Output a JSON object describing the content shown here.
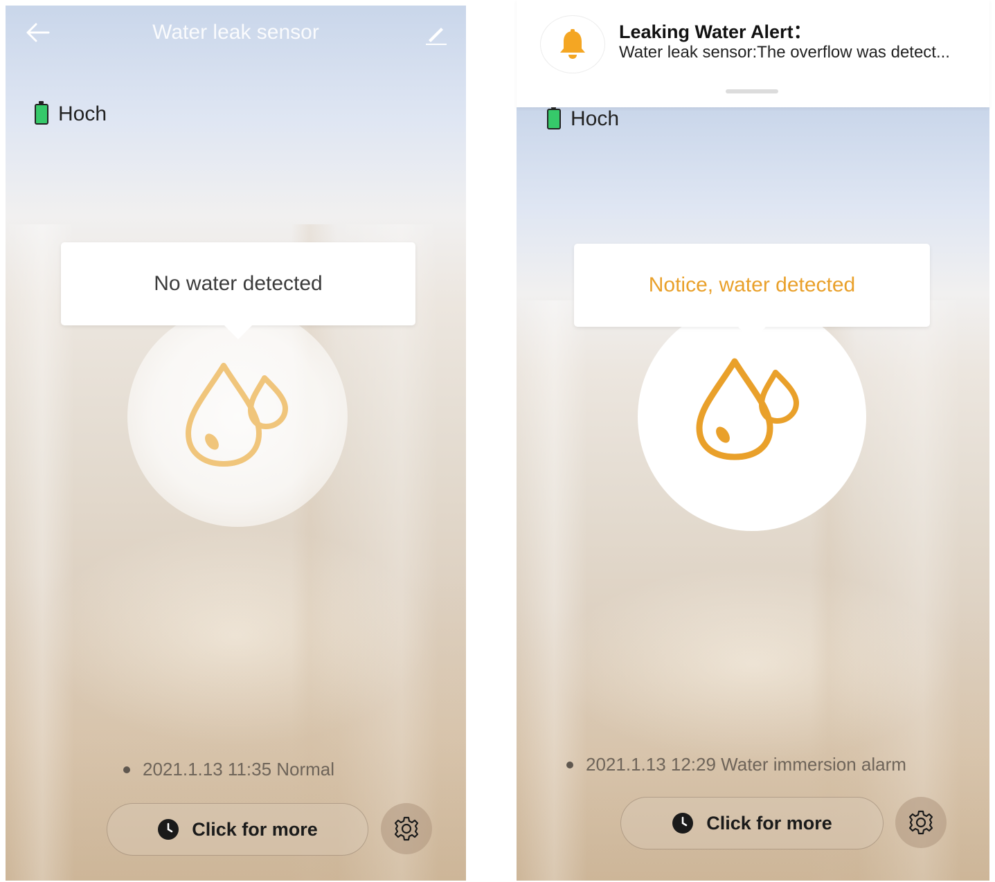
{
  "left_screen": {
    "header": {
      "title": "Water leak sensor"
    },
    "battery": {
      "label": "Hoch"
    },
    "status": {
      "text": "No water detected"
    },
    "log": {
      "entry": "2021.1.13 11:35 Normal"
    },
    "more_button": {
      "label": "Click for more"
    }
  },
  "right_screen": {
    "notification": {
      "title": "Leaking Water Alert：",
      "body": "Water leak sensor:The overflow was detect..."
    },
    "battery": {
      "label": "Hoch"
    },
    "status": {
      "text": "Notice, water detected"
    },
    "log": {
      "entry": "2021.1.13 12:29 Water immersion alarm"
    },
    "more_button": {
      "label": "Click for more"
    }
  },
  "colors": {
    "accent_orange": "#e9a02a",
    "accent_orange_light": "#f0c57b",
    "battery_green": "#36c96a",
    "text_dark": "#222222",
    "log_text": "#6e6459"
  },
  "icons": [
    "back-arrow-icon",
    "edit-icon",
    "battery-icon",
    "water-drops-icon",
    "clock-icon",
    "gear-icon",
    "bell-icon"
  ]
}
